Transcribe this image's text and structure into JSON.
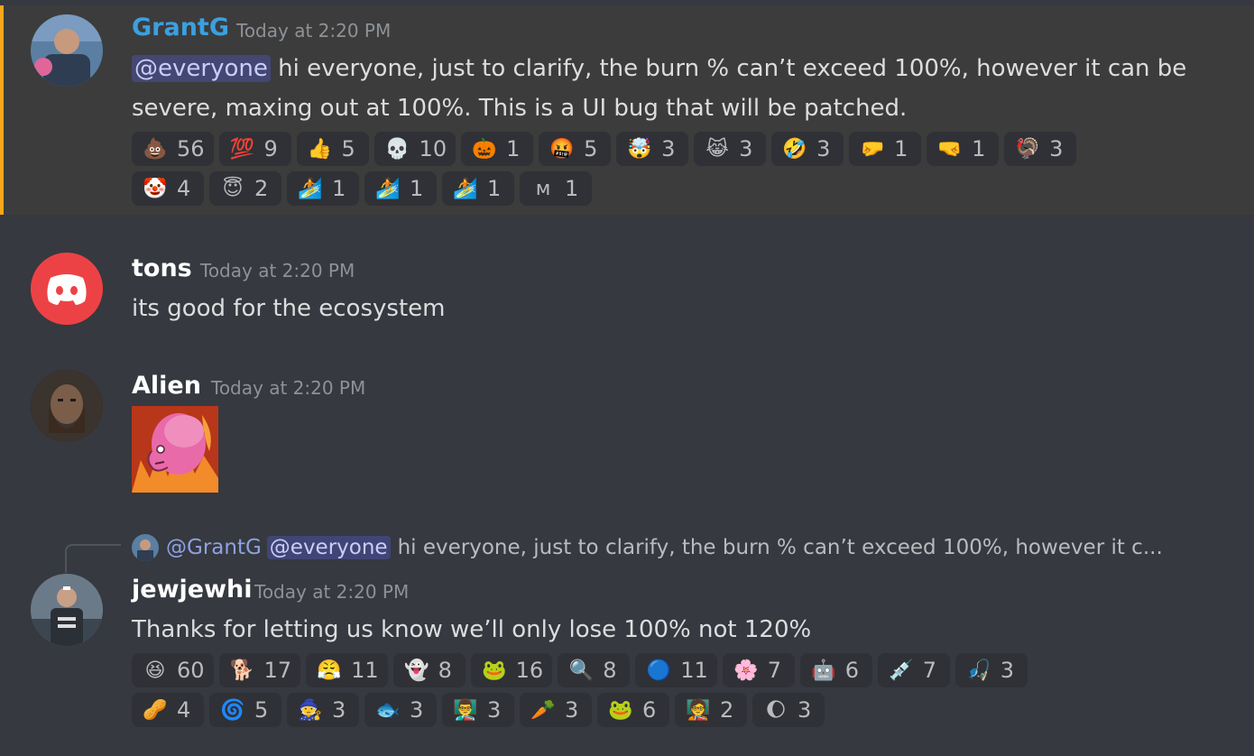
{
  "messages": [
    {
      "author": "GrantG",
      "author_color": "#3ba0e0",
      "time": "Today at 2:20 PM",
      "mention": "@everyone",
      "text": " hi everyone, just to clarify, the burn % can’t exceed 100%, however it can be severe, maxing out at 100%. This is a UI bug that will be patched.",
      "reactions": [
        {
          "icon": "poop-icon",
          "glyph": "💩",
          "count": "56"
        },
        {
          "icon": "hundred-points-icon",
          "glyph": "💯",
          "count": "9"
        },
        {
          "icon": "thumbs-up-icon",
          "glyph": "👍",
          "count": "5"
        },
        {
          "icon": "skull-icon",
          "glyph": "💀",
          "count": "10"
        },
        {
          "icon": "jack-o-lantern-icon",
          "glyph": "🎃",
          "count": "1"
        },
        {
          "icon": "cursing-face-icon",
          "glyph": "🤬",
          "count": "5"
        },
        {
          "icon": "exploding-head-icon",
          "glyph": "🤯",
          "count": "3"
        },
        {
          "icon": "cat-tears-of-joy-icon",
          "glyph": "😹",
          "count": "3"
        },
        {
          "icon": "rolling-laughing-icon",
          "glyph": "🤣",
          "count": "3"
        },
        {
          "icon": "left-fist-icon",
          "glyph": "🤛",
          "count": "1"
        },
        {
          "icon": "right-fist-icon",
          "glyph": "🤜",
          "count": "1"
        },
        {
          "icon": "turkey-icon",
          "glyph": "🦃",
          "count": "3"
        },
        {
          "icon": "clown-face-icon",
          "glyph": "🤡",
          "count": "4"
        },
        {
          "icon": "smiling-halo-icon",
          "glyph": "😇",
          "count": "2"
        },
        {
          "icon": "surfer-icon",
          "glyph": "🏄",
          "count": "1"
        },
        {
          "icon": "surfer-icon",
          "glyph": "🏄",
          "count": "1"
        },
        {
          "icon": "surfer-icon",
          "glyph": "🏄",
          "count": "1"
        },
        {
          "icon": "m-logo-icon",
          "glyph": "ᴍ",
          "count": "1"
        }
      ]
    },
    {
      "author": "tons",
      "time": "Today at 2:20 PM",
      "text": "its good for the ecosystem"
    },
    {
      "author": "Alien",
      "time": "Today at 2:20 PM"
    },
    {
      "author": "jewjewhi",
      "time": "Today at 2:20 PM",
      "reply_author": "@GrantG",
      "reply_mention": "@everyone",
      "reply_text": "hi everyone, just to clarify, the burn % can’t exceed 100%, however it c...",
      "text": "Thanks for letting us know we’ll only lose 100% not 120%",
      "reactions": [
        {
          "icon": "grinning-squint-icon",
          "glyph": "😆",
          "count": "60"
        },
        {
          "icon": "doge-icon",
          "glyph": "🐕",
          "count": "17"
        },
        {
          "icon": "wojak-icon",
          "glyph": "😤",
          "count": "11"
        },
        {
          "icon": "ghost-icon",
          "glyph": "👻",
          "count": "8"
        },
        {
          "icon": "blue-pepe-icon",
          "glyph": "🐸",
          "count": "16"
        },
        {
          "icon": "pepe-magnify-icon",
          "glyph": "🔍",
          "count": "8"
        },
        {
          "icon": "blob-icon",
          "glyph": "🔵",
          "count": "11"
        },
        {
          "icon": "anime-girl-icon",
          "glyph": "🌸",
          "count": "7"
        },
        {
          "icon": "robot-icon",
          "glyph": "🤖",
          "count": "6"
        },
        {
          "icon": "syringe-icon",
          "glyph": "💉",
          "count": "7"
        },
        {
          "icon": "fishing-icon",
          "glyph": "🎣",
          "count": "3"
        },
        {
          "icon": "peanut-icon",
          "glyph": "🥜",
          "count": "4"
        },
        {
          "icon": "cursed-smile-icon",
          "glyph": "🌀",
          "count": "5"
        },
        {
          "icon": "wizard-icon",
          "glyph": "🧙",
          "count": "3"
        },
        {
          "icon": "purple-fish-icon",
          "glyph": "🐟",
          "count": "3"
        },
        {
          "icon": "presenter-icon",
          "glyph": "👨‍🏫",
          "count": "3"
        },
        {
          "icon": "carrot-icon",
          "glyph": "🥕",
          "count": "3"
        },
        {
          "icon": "pepe-icon",
          "glyph": "🐸",
          "count": "6"
        },
        {
          "icon": "teacher-icon",
          "glyph": "🧑‍🏫",
          "count": "2"
        },
        {
          "icon": "moon-icon",
          "glyph": "🌔",
          "count": "3"
        }
      ]
    }
  ],
  "colors": {
    "background": "#36393f",
    "highlight": "#3c3c3c",
    "highlight_bar": "#faa61a",
    "discord_red": "#ed4245"
  }
}
